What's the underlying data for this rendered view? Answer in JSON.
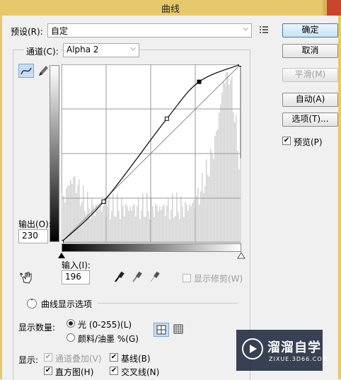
{
  "window": {
    "title": "曲线"
  },
  "preset": {
    "label": "预设(R):",
    "value": "自定",
    "menu_icon": "preset-options-icon"
  },
  "channel": {
    "label": "通道(C):",
    "value": "Alpha 2"
  },
  "tools": {
    "curve_tool": "curve-point-icon",
    "pencil_tool": "pencil-icon"
  },
  "output": {
    "label": "输出(O):",
    "value": "230"
  },
  "input": {
    "label": "输入(I):",
    "value": "196"
  },
  "buttons": {
    "ok": "确定",
    "cancel": "取消",
    "smooth": "平滑(M)",
    "auto": "自动(A)",
    "options": "选项(T)..."
  },
  "preview": {
    "label": "预览(P)",
    "checked": true
  },
  "show_clipping": {
    "label": "显示修剪(W)",
    "checked": false
  },
  "display_options": {
    "title": "曲线显示选项"
  },
  "show_amount": {
    "label": "显示数量:",
    "light": "光 (0-255)(L)",
    "pigment": "颜料/油墨 %(G)"
  },
  "show": {
    "label": "显示:",
    "channel_overlays": "通道叠加(V)",
    "baseline": "基线(B)",
    "histogram": "直方图(H)",
    "intersection": "交叉线(N)"
  },
  "watermark": {
    "brand": "溜溜自学",
    "url": "ZIXUE.3D66.COM"
  },
  "colors": {
    "accent": "#3c7fb1",
    "titlebar": "#e7c96b"
  },
  "chart_data": {
    "type": "line",
    "x_range": [
      0,
      255
    ],
    "y_range": [
      0,
      255
    ],
    "curve_points": [
      [
        0,
        0
      ],
      [
        60,
        58
      ],
      [
        150,
        177
      ],
      [
        196,
        230
      ],
      [
        255,
        255
      ]
    ],
    "baseline": [
      [
        0,
        0
      ],
      [
        255,
        255
      ]
    ],
    "histogram_note": "luminance histogram, dense in shadows and highlights",
    "grid": "4x4"
  }
}
